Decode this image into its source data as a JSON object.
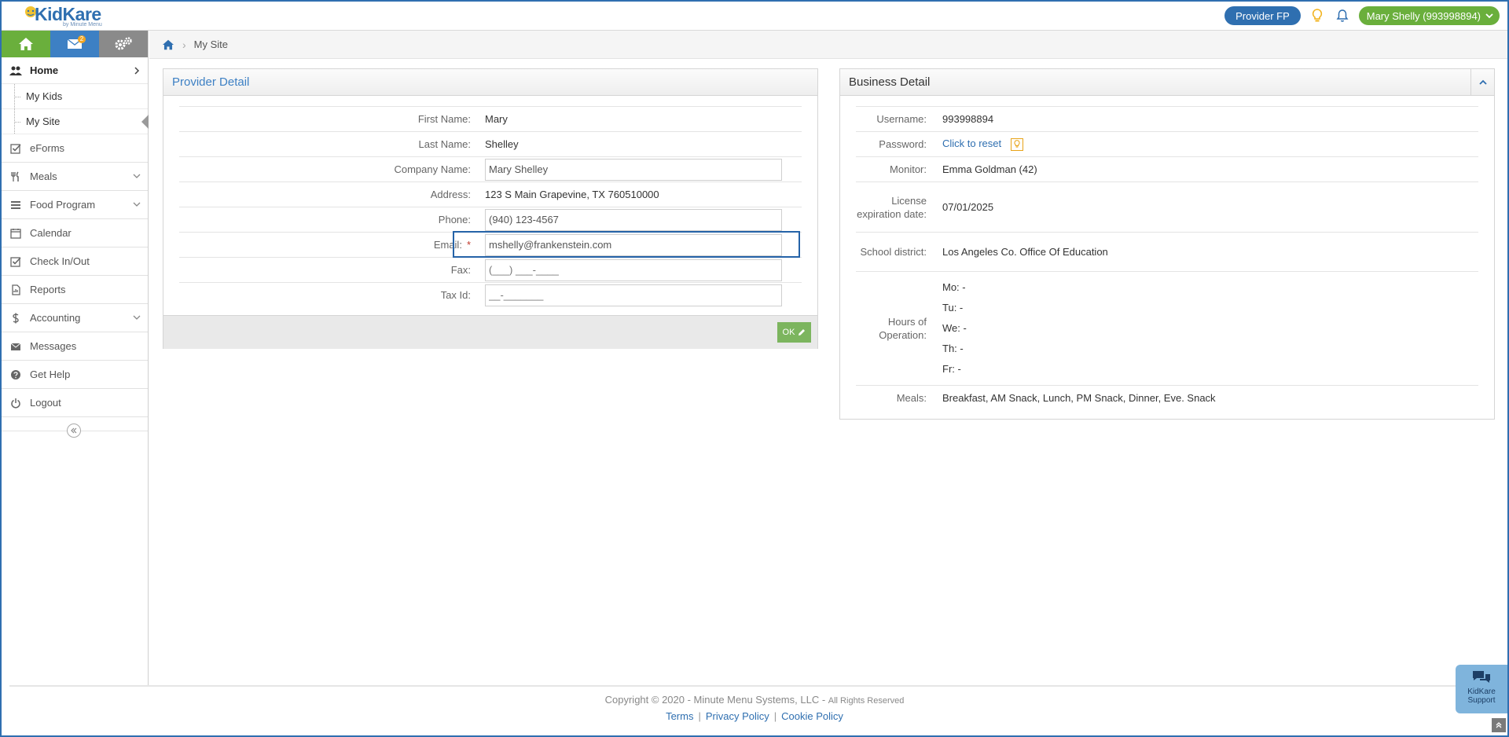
{
  "header": {
    "logo_text": "KidKare",
    "logo_sub": "by Minute Menu",
    "provider_button": "Provider FP",
    "user_button": "Mary Shelly (993998894)"
  },
  "sidebar": {
    "tabs": [
      {
        "icon": "home-icon"
      },
      {
        "icon": "mail-icon",
        "badge": "2"
      },
      {
        "icon": "gears-icon"
      }
    ],
    "home": "Home",
    "sub_items": [
      "My Kids",
      "My Site"
    ],
    "items": [
      {
        "label": "eForms",
        "icon": "check-square-icon",
        "expand": false
      },
      {
        "label": "Meals",
        "icon": "utensils-icon",
        "expand": true
      },
      {
        "label": "Food Program",
        "icon": "list-icon",
        "expand": true
      },
      {
        "label": "Calendar",
        "icon": "calendar-icon",
        "expand": false
      },
      {
        "label": "Check In/Out",
        "icon": "check-square-icon",
        "expand": false
      },
      {
        "label": "Reports",
        "icon": "report-icon",
        "expand": false
      },
      {
        "label": "Accounting",
        "icon": "dollar-icon",
        "expand": true
      },
      {
        "label": "Messages",
        "icon": "envelope-icon",
        "expand": false
      },
      {
        "label": "Get Help",
        "icon": "question-icon",
        "expand": false
      },
      {
        "label": "Logout",
        "icon": "power-icon",
        "expand": false
      }
    ]
  },
  "breadcrumb": {
    "current": "My Site"
  },
  "provider_detail": {
    "title": "Provider Detail",
    "first_name_label": "First Name:",
    "first_name": "Mary",
    "last_name_label": "Last Name:",
    "last_name": "Shelley",
    "company_label": "Company Name:",
    "company_value": "Mary Shelley",
    "address_label": "Address:",
    "address": "123 S Main Grapevine, TX 760510000",
    "phone_label": "Phone:",
    "phone_value": "(940) 123-4567",
    "email_label": "Email:",
    "email_required": "*",
    "email_value": "mshelly@frankenstein.com",
    "fax_label": "Fax:",
    "fax_placeholder": "(___) ___-____",
    "tax_label": "Tax Id:",
    "tax_placeholder": "__-_______",
    "ok_button": "OK"
  },
  "business_detail": {
    "title": "Business Detail",
    "username_label": "Username:",
    "username": "993998894",
    "password_label": "Password:",
    "password_link": "Click to reset",
    "monitor_label": "Monitor:",
    "monitor": "Emma Goldman (42)",
    "license_label": "License expiration date:",
    "license_date": "07/01/2025",
    "school_label": "School district:",
    "school": "Los Angeles Co. Office Of Education",
    "hours_label": "Hours of Operation:",
    "hours": [
      "Mo: -",
      "Tu: -",
      "We: -",
      "Th: -",
      "Fr: -"
    ],
    "meals_label": "Meals:",
    "meals": "Breakfast, AM Snack, Lunch, PM Snack, Dinner, Eve. Snack"
  },
  "footer": {
    "copyright": "Copyright © 2020 - Minute Menu Systems, LLC -",
    "rights": "All Rights Reserved",
    "links": [
      "Terms",
      "Privacy Policy",
      "Cookie Policy"
    ]
  },
  "support": {
    "line1": "KidKare",
    "line2": "Support"
  },
  "colors": {
    "brand_blue": "#2f6fb0",
    "green": "#6aaf3c",
    "focus_border": "#2563a8"
  }
}
